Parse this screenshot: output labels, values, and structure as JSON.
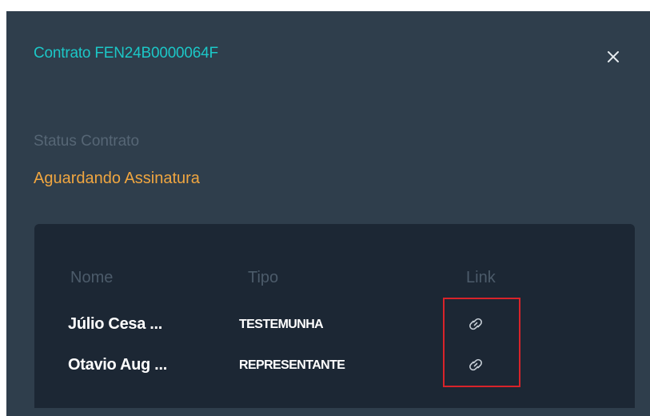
{
  "modal": {
    "title": "Contrato FEN24B0000064F",
    "status_label": "Status Contrato",
    "status_value": "Aguardando Assinatura"
  },
  "table": {
    "headers": [
      "Nome",
      "Tipo",
      "Link"
    ],
    "rows": [
      {
        "name": "Júlio Cesa ...",
        "type": "TESTEMUNHA",
        "link_icon": "link-icon"
      },
      {
        "name": "Otavio Aug ...",
        "type": "REPRESENTANTE",
        "link_icon": "link-icon"
      }
    ]
  },
  "colors": {
    "panel_bg": "#2f3e4c",
    "table_bg": "#1c2734",
    "title": "#1cc7c7",
    "status_value": "#f0a640",
    "highlight": "#d8232a"
  }
}
